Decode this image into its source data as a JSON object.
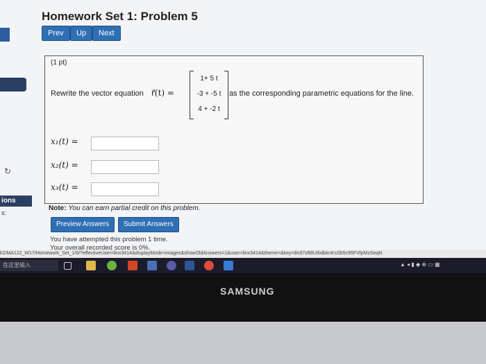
{
  "header": {
    "title": "Homework Set 1: Problem 5"
  },
  "nav": {
    "prev": "Prev",
    "up": "Up",
    "next": "Next"
  },
  "sidebar": {
    "label": "ions",
    "label2": "s:"
  },
  "problem": {
    "points": "(1 pt)",
    "prompt_start": "Rewrite the vector equation",
    "vector_fn": "r⃗(t) =",
    "matrix": [
      "1+ 5 t",
      "-3 + -5 t",
      "4 + -2 t"
    ],
    "prompt_end": "as the corresponding parametric equations for the line.",
    "fields": [
      {
        "label": "x₁(t) =",
        "value": ""
      },
      {
        "label": "x₂(t) =",
        "value": ""
      },
      {
        "label": "x₃(t) =",
        "value": ""
      }
    ]
  },
  "note": {
    "bold": "Note:",
    "text": "You can earn partial credit on this problem."
  },
  "actions": {
    "preview": "Preview Answers",
    "submit": "Submit Answers"
  },
  "messages": {
    "attempts": "You have attempted this problem 1 time.",
    "score": "Your overall recorded score is 0%."
  },
  "statusbar": {
    "url": "k2/MA122_W17/Homework_Set_1/6/?effectiveUser=linx3414&displayMode=images&showOldAnswers=1&user=linx3414&theme=&key=8n97oft8UIbdbknKsSb5c95FVfpMzSeqN"
  },
  "taskbar": {
    "search": "在这里输入"
  },
  "device": {
    "brand": "SAMSUNG"
  },
  "colors": {
    "accent": "#2f6fb4",
    "page_bg": "#f3f4f6"
  }
}
